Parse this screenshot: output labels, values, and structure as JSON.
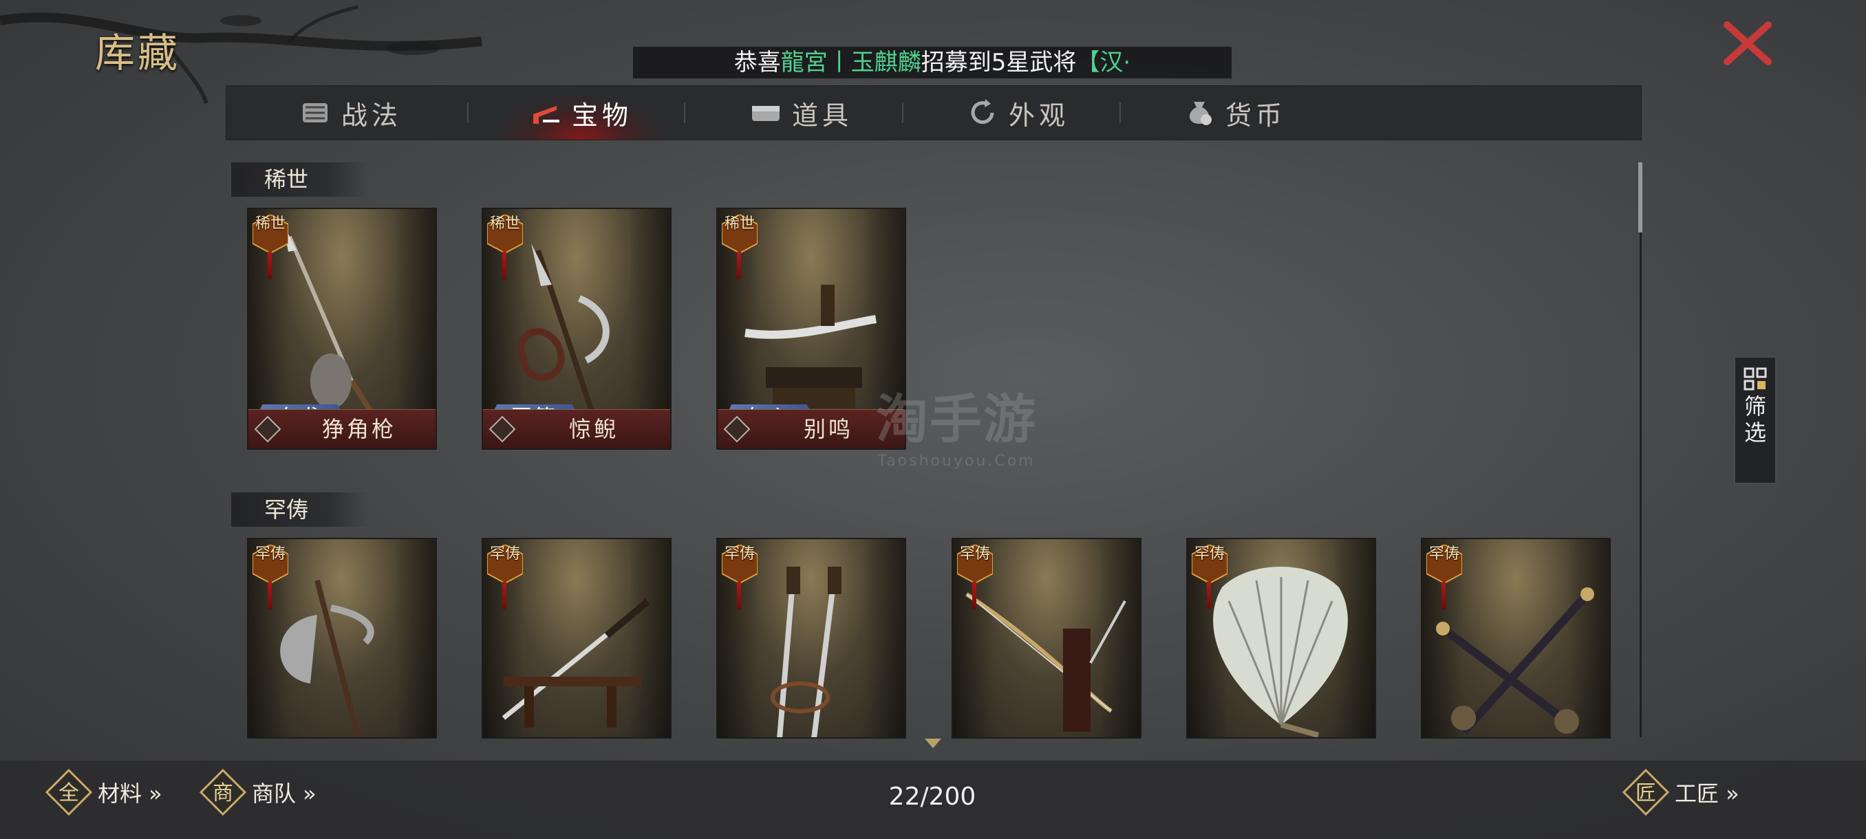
{
  "header": {
    "title": "库藏",
    "announcement": {
      "prefix": "恭喜",
      "server": "龍宮",
      "divider": "丨",
      "player": "玉麒麟",
      "middle": "招募到5星武将",
      "suffix": "【汉·"
    }
  },
  "tabs": [
    {
      "label": "战法",
      "icon": "scroll-icon"
    },
    {
      "label": "宝物",
      "icon": "treasure-icon",
      "active": true
    },
    {
      "label": "道具",
      "icon": "chest-icon"
    },
    {
      "label": "外观",
      "icon": "refresh-icon"
    },
    {
      "label": "货币",
      "icon": "money-bag-icon"
    }
  ],
  "sections": [
    {
      "label": "稀世",
      "items": [
        {
          "tag": "稀世",
          "hero": "奔袭",
          "grade": "極",
          "name": "狰角枪",
          "art": "spear"
        },
        {
          "tag": "稀世",
          "hero": "至策",
          "grade": "極",
          "name": "惊鲵",
          "art": "halberd"
        },
        {
          "tag": "稀世",
          "hero": "仁心",
          "grade": "極",
          "name": "别鸣",
          "art": "sword-stand"
        }
      ]
    },
    {
      "label": "罕俦",
      "items": [
        {
          "tag": "罕俦",
          "art": "axe"
        },
        {
          "tag": "罕俦",
          "art": "katana"
        },
        {
          "tag": "罕俦",
          "art": "twin-swords"
        },
        {
          "tag": "罕俦",
          "art": "bow"
        },
        {
          "tag": "罕俦",
          "art": "feather-fan"
        },
        {
          "tag": "罕俦",
          "art": "crossed-maces"
        }
      ]
    }
  ],
  "filter": {
    "label_line1": "筛",
    "label_line2": "选"
  },
  "footer": {
    "materials": "材料 »",
    "caravan": "商队 »",
    "count": "22/200",
    "craftsman": "工匠 »",
    "materials_icon_char": "全",
    "caravan_icon_char": "商",
    "craftsman_icon_char": "匠"
  },
  "watermark": {
    "line1": "淘手游",
    "line2": "Taoshouyou.Com"
  },
  "colors": {
    "accent_green": "#4fd28e",
    "close_red": "#c83a3a",
    "title_gold": "#d9bd86"
  }
}
